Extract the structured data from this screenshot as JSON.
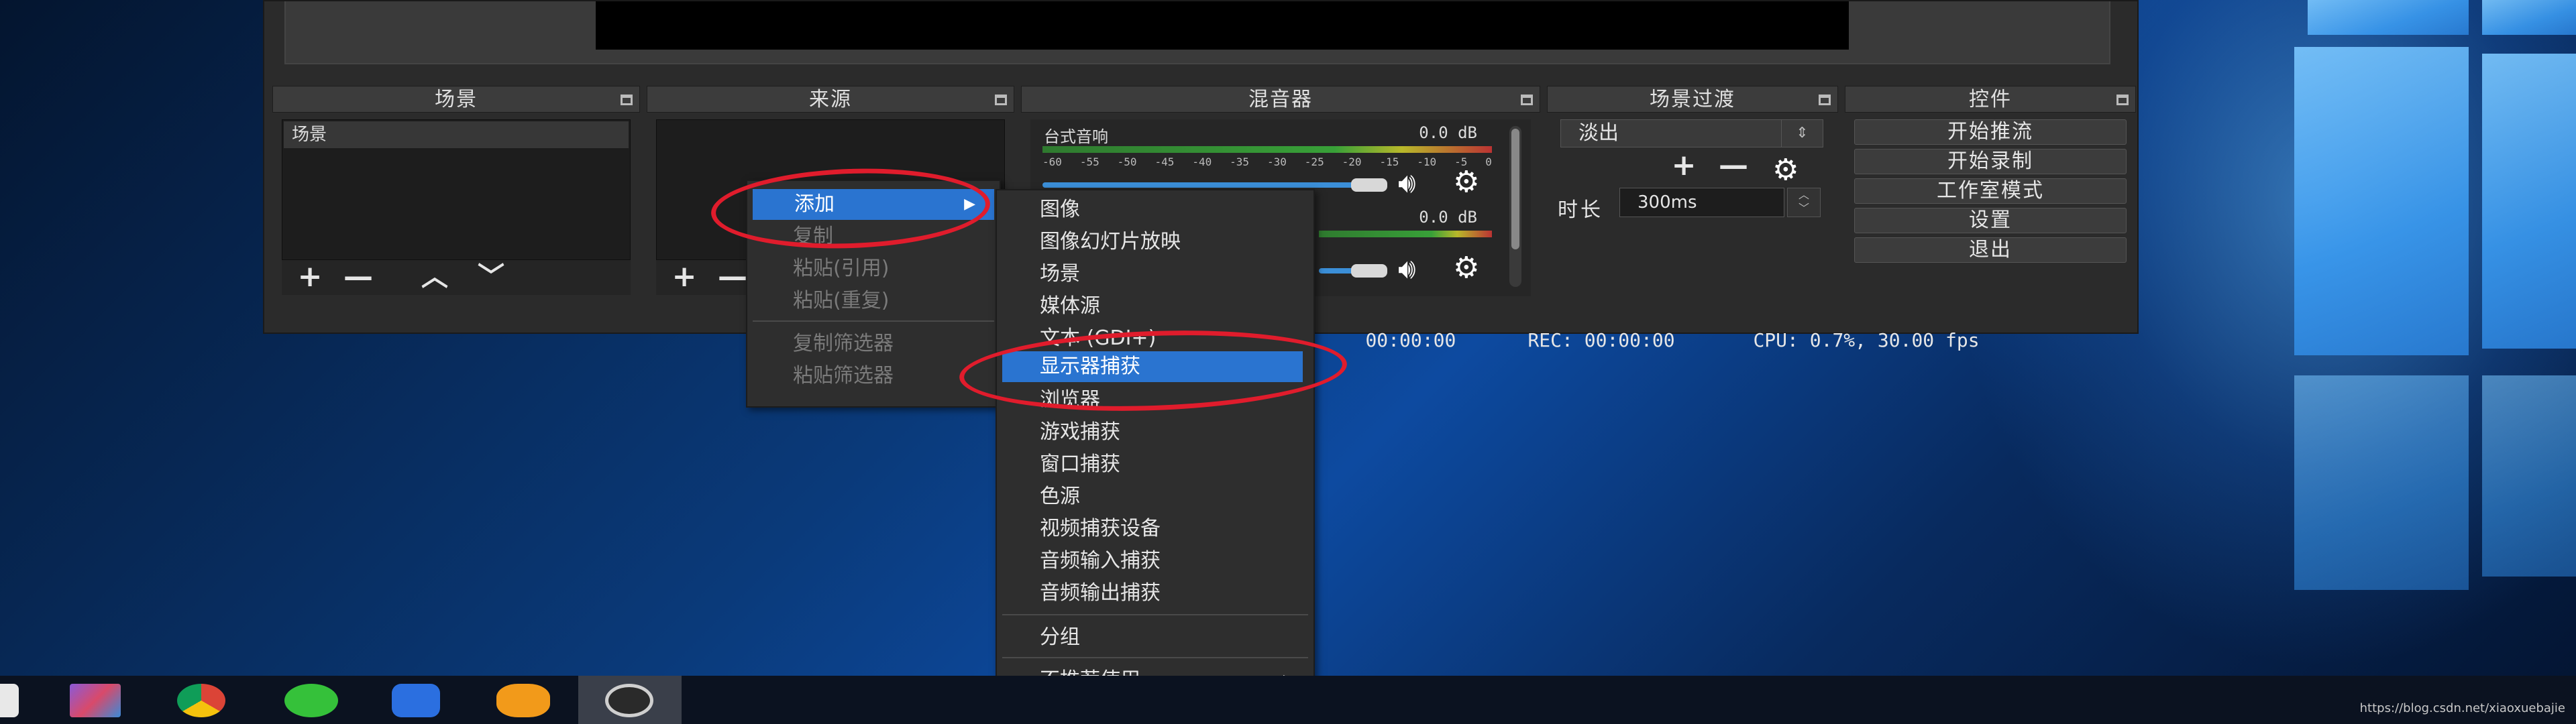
{
  "docks": {
    "scenes": {
      "title": "场景",
      "items": [
        "场景"
      ]
    },
    "sources": {
      "title": "来源"
    },
    "mixer": {
      "title": "混音器",
      "tracks": [
        {
          "name": "台式音响",
          "db": "0.0 dB"
        },
        {
          "name": "",
          "db": "0.0 dB"
        }
      ],
      "scale": [
        "-60",
        "-55",
        "-50",
        "-45",
        "-40",
        "-35",
        "-30",
        "-25",
        "-20",
        "-15",
        "-10",
        "-5",
        "0"
      ]
    },
    "transitions": {
      "title": "场景过渡",
      "selected": "淡出",
      "duration_label": "时长",
      "duration_value": "300ms"
    },
    "controls": {
      "title": "控件",
      "buttons": [
        "开始推流",
        "开始录制",
        "工作室模式",
        "设置",
        "退出"
      ]
    }
  },
  "status": {
    "live": "00:00:00",
    "rec": "REC: 00:00:00",
    "cpu": "CPU: 0.7%, 30.00 fps"
  },
  "context_menu": {
    "items": [
      "添加",
      "复制",
      "粘贴(引用)",
      "粘贴(重复)",
      "复制筛选器",
      "粘贴筛选器"
    ],
    "selected": "添加"
  },
  "add_submenu": {
    "items": [
      "图像",
      "图像幻灯片放映",
      "场景",
      "媒体源",
      "文本 (GDI+)",
      "显示器捕获",
      "浏览器",
      "游戏捕获",
      "窗口捕获",
      "色源",
      "视频捕获设备",
      "音频输入捕获",
      "音频输出捕获",
      "分组",
      "不推荐使用"
    ],
    "selected": "显示器捕获"
  },
  "watermark": "https://blog.csdn.net/xiaoxuebajie",
  "colors": {
    "highlight": "#2a74d0",
    "annotation": "#e01c2c"
  }
}
